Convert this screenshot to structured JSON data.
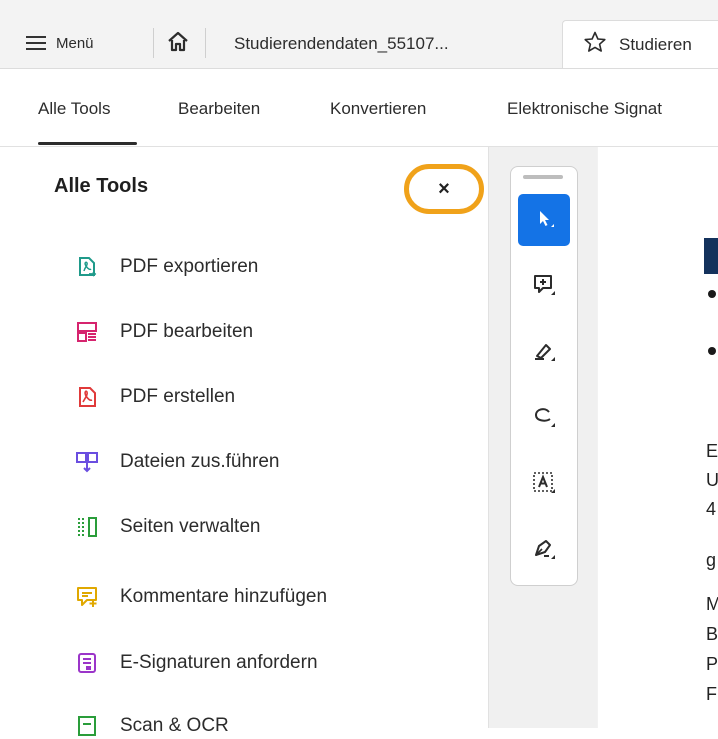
{
  "tabbar": {
    "menu_label": "Menü",
    "doc_tab_1": "Studierendendaten_55107...",
    "doc_tab_2": "Studieren"
  },
  "toolsnav": {
    "items": [
      "Alle Tools",
      "Bearbeiten",
      "Konvertieren",
      "Elektronische Signat"
    ],
    "active": "Alle Tools"
  },
  "panel": {
    "title": "Alle Tools",
    "close_label": "×",
    "tools": [
      {
        "label": "PDF exportieren",
        "icon": "export-pdf-icon",
        "color": "#1f9a8a"
      },
      {
        "label": "PDF bearbeiten",
        "icon": "edit-pdf-icon",
        "color": "#d6246e"
      },
      {
        "label": "PDF erstellen",
        "icon": "create-pdf-icon",
        "color": "#e03a3a"
      },
      {
        "label": "Dateien zus.führen",
        "icon": "combine-files-icon",
        "color": "#6a4ee0"
      },
      {
        "label": "Seiten verwalten",
        "icon": "organize-pages-icon",
        "color": "#2a9d3a"
      },
      {
        "label": "Kommentare hinzufügen",
        "icon": "comment-add-icon",
        "color": "#e0a800"
      },
      {
        "label": "E-Signaturen anfordern",
        "icon": "request-esign-icon",
        "color": "#9b35c9"
      },
      {
        "label": "Scan & OCR",
        "icon": "scan-ocr-icon",
        "color": "#2a9d3a"
      }
    ]
  },
  "quicktools": [
    {
      "name": "select-cursor-icon",
      "active": true
    },
    {
      "name": "add-comment-icon",
      "active": false
    },
    {
      "name": "highlight-pen-icon",
      "active": false
    },
    {
      "name": "draw-freeform-icon",
      "active": false
    },
    {
      "name": "text-select-icon",
      "active": false
    },
    {
      "name": "sign-pen-icon",
      "active": false
    }
  ],
  "document": {
    "lines": [
      "E",
      "U",
      "4",
      "g",
      "M",
      "B",
      "P",
      "F"
    ]
  },
  "colors": {
    "accent_blue": "#1473e6",
    "highlight_ring": "#f0a21a"
  }
}
